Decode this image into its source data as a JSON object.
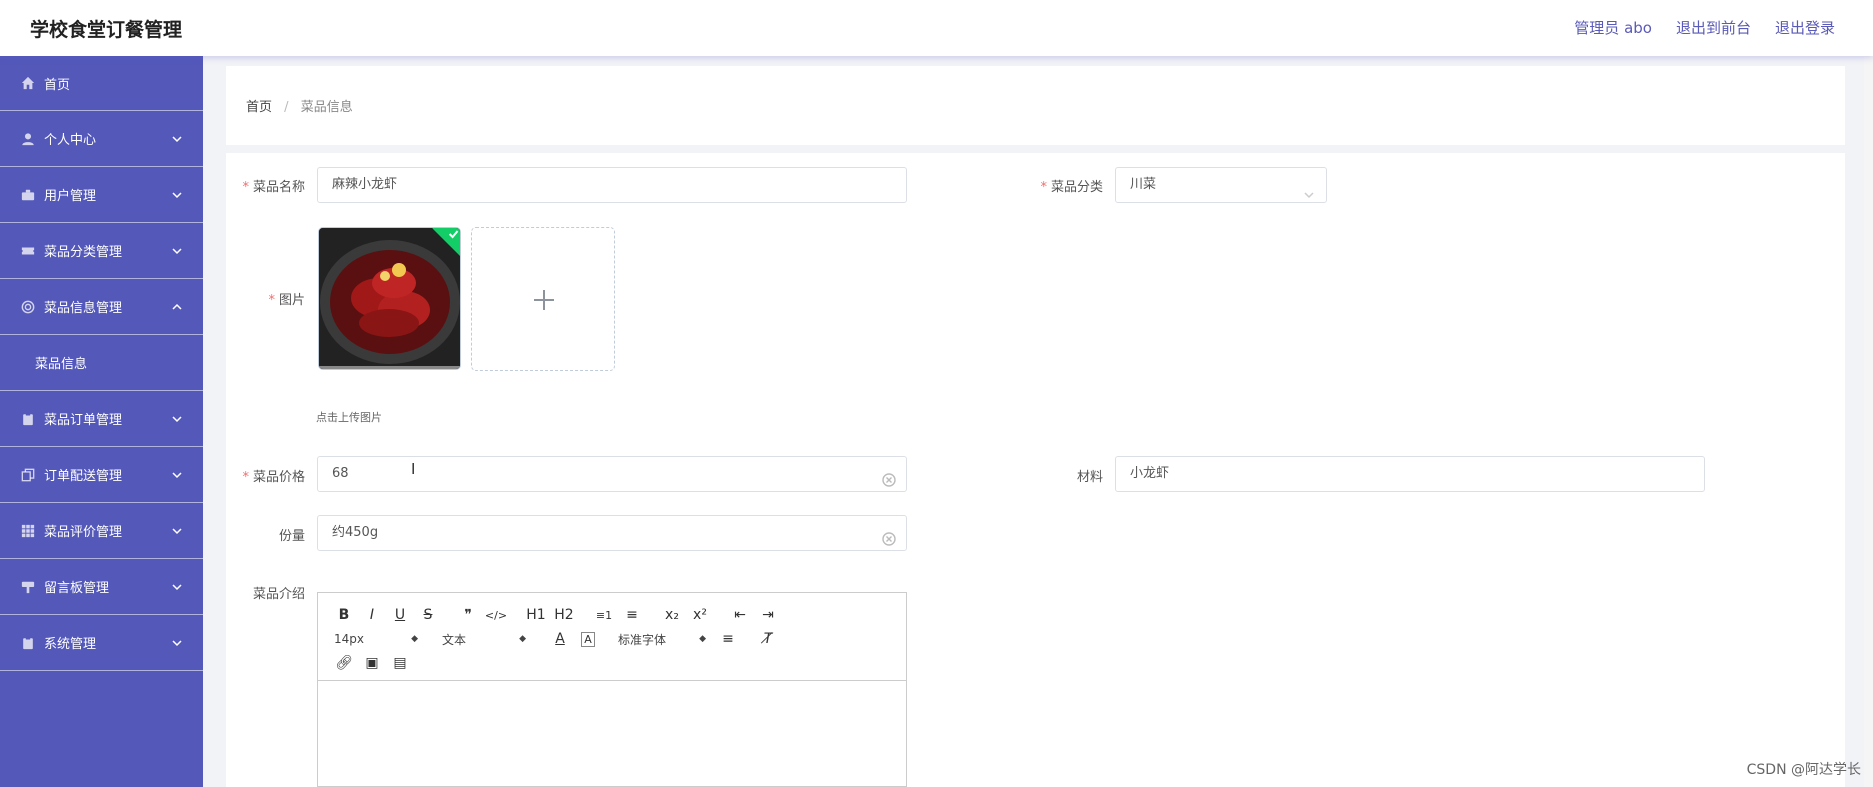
{
  "header": {
    "title": "学校食堂订餐管理",
    "admin_label": "管理员 abo",
    "exit_front": "退出到前台",
    "logout": "退出登录"
  },
  "sidebar": {
    "items": [
      {
        "label": "首页",
        "icon": "home-icon"
      },
      {
        "label": "个人中心",
        "icon": "user-icon"
      },
      {
        "label": "用户管理",
        "icon": "briefcase-icon"
      },
      {
        "label": "菜品分类管理",
        "icon": "ticket-icon"
      },
      {
        "label": "菜品信息管理",
        "icon": "ring-icon",
        "expanded": true,
        "sub": [
          "菜品信息"
        ]
      },
      {
        "label": "菜品订单管理",
        "icon": "clipboard-icon"
      },
      {
        "label": "订单配送管理",
        "icon": "copy-icon"
      },
      {
        "label": "菜品评价管理",
        "icon": "grid-icon"
      },
      {
        "label": "留言板管理",
        "icon": "signpost-icon"
      },
      {
        "label": "系统管理",
        "icon": "clipboard-icon"
      }
    ]
  },
  "breadcrumb": {
    "home": "首页",
    "separator": "/",
    "current": "菜品信息"
  },
  "form": {
    "name_label": "菜品名称",
    "name_value": "麻辣小龙虾",
    "category_label": "菜品分类",
    "category_value": "川菜",
    "image_label": "图片",
    "upload_tip": "点击上传图片",
    "price_label": "菜品价格",
    "price_value": "68",
    "material_label": "材料",
    "material_value": "小龙虾",
    "portion_label": "份量",
    "portion_value": "约450g",
    "intro_label": "菜品介绍"
  },
  "editor": {
    "font_size": "14px",
    "text_type": "文本",
    "font_family": "标准字体",
    "buttons_row1": [
      "B",
      "I",
      "U",
      "S",
      "❞",
      "</>",
      "H1",
      "H2",
      "≡1",
      "≡",
      "x₂",
      "x²",
      "⇤",
      "⇥"
    ]
  },
  "watermark": "CSDN @阿达学长",
  "colors": {
    "sidebar_bg": "#5358b9",
    "accent": "#5a5ab8",
    "required": "#f56c6c",
    "success": "#13ce66"
  }
}
